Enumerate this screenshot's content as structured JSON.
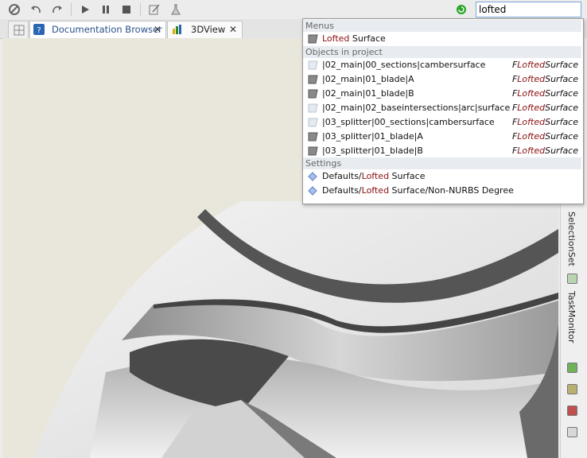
{
  "toolbar": {
    "search_value": "lofted",
    "icons": [
      "stop-circle-icon",
      "undo-icon",
      "redo-icon",
      "play-icon",
      "pause-icon",
      "stop-icon",
      "edit-icon",
      "flask-icon",
      "status-ok-icon"
    ]
  },
  "tabs": [
    {
      "label": "Documentation Browser",
      "close": "✕"
    },
    {
      "label": "3DView",
      "close": "✕"
    }
  ],
  "popup": {
    "sections": {
      "menus": "Menus",
      "objects": "Objects in project",
      "settings": "Settings"
    },
    "menus": [
      {
        "hl": "Lofted",
        "rest": " Surface"
      }
    ],
    "objects": [
      {
        "name": "|02_main|00_sections|cambersurface",
        "type_pre": "F",
        "type_hl": "Lofted",
        "type_post": "Surface",
        "icon": "faint"
      },
      {
        "name": "|02_main|01_blade|A",
        "type_pre": "F",
        "type_hl": "Lofted",
        "type_post": "Surface",
        "icon": "solid"
      },
      {
        "name": "|02_main|01_blade|B",
        "type_pre": "F",
        "type_hl": "Lofted",
        "type_post": "Surface",
        "icon": "solid"
      },
      {
        "name": "|02_main|02_baseintersections|arc|surface",
        "type_pre": "F",
        "type_hl": "Lofted",
        "type_post": "Surface",
        "icon": "faint"
      },
      {
        "name": "|03_splitter|00_sections|cambersurface",
        "type_pre": "F",
        "type_hl": "Lofted",
        "type_post": "Surface",
        "icon": "faint"
      },
      {
        "name": "|03_splitter|01_blade|A",
        "type_pre": "F",
        "type_hl": "Lofted",
        "type_post": "Surface",
        "icon": "solid"
      },
      {
        "name": "|03_splitter|01_blade|B",
        "type_pre": "F",
        "type_hl": "Lofted",
        "type_post": "Surface",
        "icon": "solid"
      }
    ],
    "settings": [
      {
        "pre": "Defaults/",
        "hl": "Lofted",
        "post": " Surface"
      },
      {
        "pre": "Defaults/",
        "hl": "Lofted",
        "post": " Surface/Non-NURBS Degree"
      }
    ]
  },
  "rightdock": {
    "tabs": [
      "SelectionSet",
      "TaskMonitor"
    ]
  },
  "colors": {
    "highlight": "#8b1010",
    "viewport_bg": "#e9e7dc",
    "accent": "#2a66b3"
  }
}
